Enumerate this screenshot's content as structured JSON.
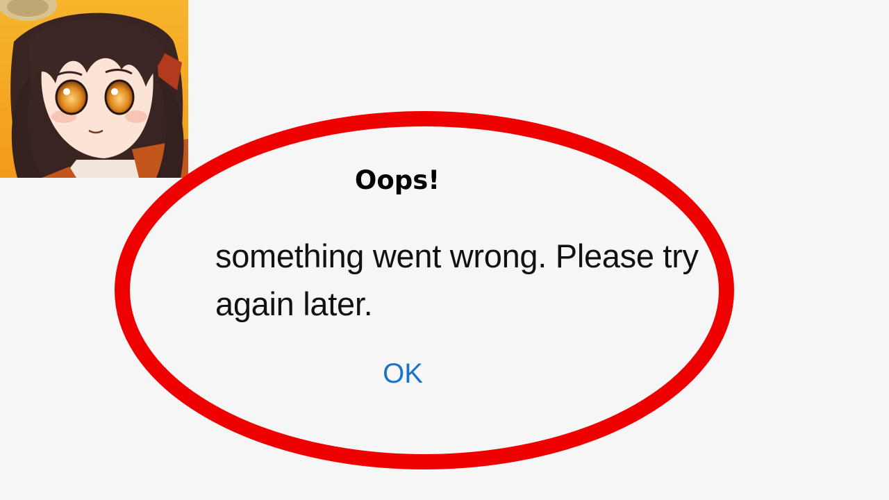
{
  "dialog": {
    "title": "Oops!",
    "message": "something went wrong. Please try again later.",
    "ok_label": "OK"
  },
  "app_icon": {
    "name": "game-app-icon",
    "depicts": "anime girl with dark hair and amber eyes on orange background"
  },
  "highlight": {
    "shape": "ellipse",
    "color": "#ee0000"
  },
  "colors": {
    "background": "#f6f6f6",
    "ok_button": "#1a73c8",
    "text": "#111111",
    "icon_background": "#f6a623"
  }
}
